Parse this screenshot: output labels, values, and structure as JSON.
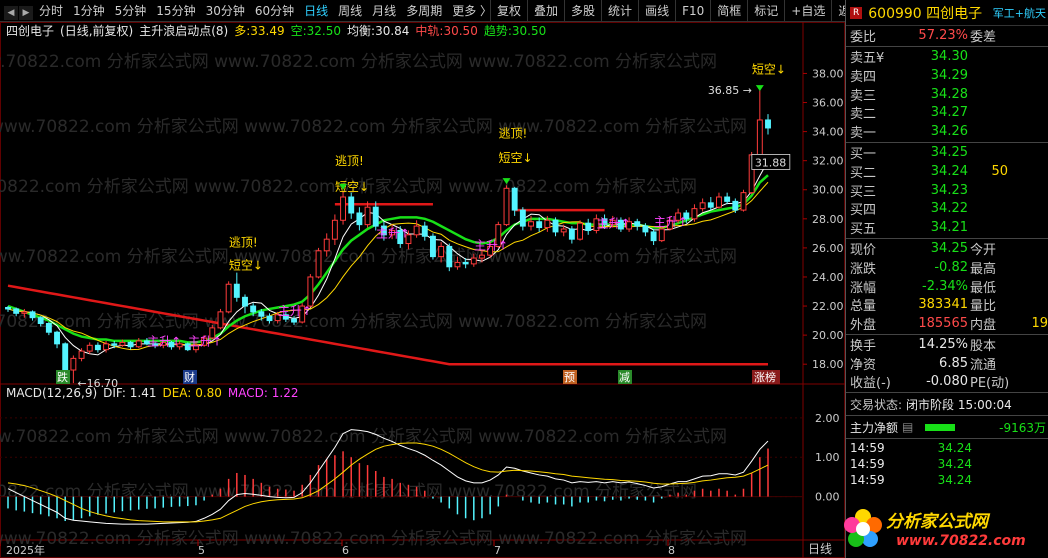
{
  "toolbar": {
    "periods": [
      "分时",
      "1分钟",
      "5分钟",
      "15分钟",
      "30分钟",
      "60分钟",
      "日线",
      "周线",
      "月线",
      "多周期",
      "更多 〉"
    ],
    "active": "日线",
    "right_buttons": [
      "复权",
      "叠加",
      "多股",
      "统计",
      "画线",
      "F10",
      "简框",
      "标记",
      "+自选",
      "返回"
    ]
  },
  "legend": {
    "stock": "四创电子",
    "mode": "(日线,前复权)",
    "indicator": "主升浪启动点(8)",
    "duo_label": "多:",
    "duo_value": "33.49",
    "kong_label": "空:",
    "kong_value": "32.50",
    "junheng_label": "均衡:",
    "junheng_value": "30.84",
    "zhonggui_label": "中轨:",
    "zhonggui_value": "30.50",
    "qushi_label": "趋势:",
    "qushi_value": "30.50"
  },
  "macd_legend": {
    "name": "MACD(12,26,9)",
    "dif_label": "DIF:",
    "dif_value": "1.41",
    "dea_label": "DEA:",
    "dea_value": "0.80",
    "macd_label": "MACD:",
    "macd_value": "1.22"
  },
  "chart_data": {
    "type": "candlestick",
    "price_axis_ticks": [
      "38.00",
      "36.00",
      "34.00",
      "32.00",
      "30.00",
      "28.00",
      "26.00",
      "24.00",
      "22.00",
      "20.00",
      "18.00"
    ],
    "macd_axis_ticks": [
      "2.00",
      "1.00",
      "0.00"
    ],
    "time_labels": [
      "2025年",
      "5",
      "6",
      "7",
      "8"
    ],
    "period_label": "日线",
    "price_range": [
      16.5,
      39.2
    ],
    "macd_range": [
      -1.0,
      2.3
    ],
    "candles": [
      [
        21.9,
        21.8,
        22.0,
        21.6
      ],
      [
        21.8,
        21.5,
        21.9,
        21.3
      ],
      [
        21.5,
        21.6,
        21.8,
        21.2
      ],
      [
        21.6,
        21.2,
        21.7,
        21.0
      ],
      [
        21.2,
        20.8,
        21.3,
        20.6
      ],
      [
        20.8,
        20.2,
        20.9,
        20.0
      ],
      [
        20.2,
        19.4,
        20.3,
        19.1
      ],
      [
        19.4,
        17.6,
        19.5,
        17.3
      ],
      [
        17.6,
        18.4,
        18.6,
        16.7
      ],
      [
        18.4,
        18.9,
        19.1,
        18.2
      ],
      [
        18.9,
        19.3,
        19.5,
        18.7
      ],
      [
        19.3,
        19.0,
        19.5,
        18.8
      ],
      [
        19.0,
        19.4,
        19.6,
        18.8
      ],
      [
        19.4,
        19.3,
        19.6,
        19.1
      ],
      [
        19.3,
        19.5,
        19.7,
        19.2
      ],
      [
        19.5,
        19.2,
        19.6,
        19.0
      ],
      [
        19.2,
        19.6,
        19.8,
        19.1
      ],
      [
        19.6,
        19.4,
        19.8,
        19.3
      ],
      [
        19.4,
        19.3,
        19.5,
        19.1
      ],
      [
        19.3,
        19.5,
        19.6,
        19.1
      ],
      [
        19.5,
        19.2,
        19.6,
        19.0
      ],
      [
        19.2,
        19.4,
        19.6,
        19.0
      ],
      [
        19.4,
        19.0,
        19.5,
        18.9
      ],
      [
        19.0,
        19.3,
        19.5,
        18.8
      ],
      [
        19.3,
        19.8,
        20.0,
        19.2
      ],
      [
        19.8,
        20.5,
        20.7,
        19.7
      ],
      [
        20.5,
        21.6,
        21.8,
        20.4
      ],
      [
        21.6,
        23.5,
        23.7,
        21.5
      ],
      [
        23.5,
        22.6,
        24.3,
        22.3
      ],
      [
        22.6,
        22.0,
        22.8,
        21.5
      ],
      [
        22.0,
        21.6,
        22.2,
        21.3
      ],
      [
        21.6,
        21.3,
        21.8,
        21.0
      ],
      [
        21.3,
        21.0,
        21.5,
        20.8
      ],
      [
        21.0,
        21.4,
        21.6,
        20.8
      ],
      [
        21.4,
        21.1,
        21.6,
        20.9
      ],
      [
        21.1,
        20.9,
        21.3,
        20.7
      ],
      [
        20.9,
        22.0,
        22.2,
        20.8
      ],
      [
        22.0,
        24.0,
        24.2,
        21.9
      ],
      [
        24.0,
        25.8,
        26.0,
        23.9
      ],
      [
        25.8,
        26.6,
        27.0,
        25.4
      ],
      [
        26.6,
        27.9,
        28.3,
        26.2
      ],
      [
        27.9,
        29.5,
        29.9,
        27.6
      ],
      [
        29.5,
        28.4,
        29.8,
        28.0
      ],
      [
        28.4,
        27.6,
        28.8,
        27.2
      ],
      [
        27.6,
        28.8,
        29.2,
        27.4
      ],
      [
        28.8,
        27.5,
        29.2,
        27.2
      ],
      [
        27.5,
        26.9,
        27.8,
        26.5
      ],
      [
        26.9,
        27.2,
        27.6,
        26.6
      ],
      [
        27.2,
        26.3,
        27.5,
        26.0
      ],
      [
        26.3,
        26.9,
        27.2,
        25.9
      ],
      [
        26.9,
        27.5,
        27.9,
        26.7
      ],
      [
        27.5,
        26.8,
        27.8,
        26.5
      ],
      [
        26.8,
        25.4,
        27.0,
        25.2
      ],
      [
        25.4,
        26.1,
        26.4,
        25.0
      ],
      [
        26.1,
        24.7,
        26.3,
        24.4
      ],
      [
        24.7,
        25.0,
        25.4,
        24.5
      ],
      [
        25.0,
        24.9,
        25.3,
        24.6
      ],
      [
        24.9,
        25.3,
        25.6,
        24.7
      ],
      [
        25.3,
        25.5,
        25.9,
        25.0
      ],
      [
        25.5,
        26.1,
        26.4,
        25.3
      ],
      [
        26.1,
        27.6,
        27.8,
        26.0
      ],
      [
        27.6,
        30.1,
        30.3,
        27.5
      ],
      [
        30.1,
        28.6,
        30.2,
        28.2
      ],
      [
        28.6,
        27.5,
        28.8,
        27.2
      ],
      [
        27.5,
        27.8,
        28.2,
        27.2
      ],
      [
        27.8,
        27.4,
        28.1,
        27.1
      ],
      [
        27.4,
        27.9,
        28.2,
        27.1
      ],
      [
        27.9,
        27.1,
        28.1,
        26.8
      ],
      [
        27.1,
        27.3,
        27.6,
        26.8
      ],
      [
        27.3,
        26.6,
        27.5,
        26.3
      ],
      [
        26.6,
        27.7,
        27.9,
        26.5
      ],
      [
        27.7,
        27.2,
        28.0,
        26.9
      ],
      [
        27.2,
        28.0,
        28.3,
        27.0
      ],
      [
        28.0,
        27.6,
        28.3,
        27.3
      ],
      [
        27.6,
        27.9,
        28.2,
        27.4
      ],
      [
        27.9,
        27.3,
        28.1,
        27.1
      ],
      [
        27.3,
        27.8,
        28.1,
        27.1
      ],
      [
        27.8,
        27.5,
        28.0,
        27.2
      ],
      [
        27.5,
        27.1,
        27.7,
        26.8
      ],
      [
        27.1,
        26.5,
        27.3,
        26.2
      ],
      [
        26.5,
        27.3,
        27.5,
        26.4
      ],
      [
        27.3,
        27.9,
        28.2,
        27.2
      ],
      [
        27.9,
        28.4,
        28.7,
        27.7
      ],
      [
        28.4,
        28.0,
        28.6,
        27.7
      ],
      [
        28.0,
        28.7,
        29.0,
        27.8
      ],
      [
        28.7,
        29.1,
        29.4,
        28.5
      ],
      [
        29.1,
        28.8,
        29.5,
        28.6
      ],
      [
        28.8,
        29.5,
        29.8,
        28.7
      ],
      [
        29.5,
        29.2,
        29.8,
        29.0
      ],
      [
        29.2,
        28.6,
        29.4,
        28.4
      ],
      [
        28.6,
        29.8,
        30.0,
        28.5
      ],
      [
        29.8,
        32.4,
        32.6,
        29.7
      ],
      [
        32.4,
        34.8,
        36.85,
        32.2
      ],
      [
        34.8,
        34.25,
        35.2,
        33.8
      ]
    ],
    "ma_red": [
      23.4,
      23.3,
      23.2,
      23.1,
      23.0,
      22.9,
      22.8,
      22.7,
      22.6,
      22.5,
      22.4,
      22.3,
      22.2,
      22.1,
      22.0,
      21.9,
      21.8,
      21.7,
      21.6,
      21.5,
      21.4,
      21.3,
      21.2,
      21.1,
      21.0,
      20.9,
      20.8,
      20.7,
      20.6,
      20.5,
      20.4,
      20.3,
      20.2,
      20.1,
      20.0,
      19.9,
      19.8,
      19.7,
      19.6,
      19.5,
      19.4,
      19.3,
      19.2,
      19.1,
      19.0,
      18.9,
      18.8,
      18.7,
      18.6,
      18.5,
      18.4,
      18.3,
      18.2,
      18.1,
      18.0,
      18.0,
      18.0,
      18.0,
      18.0,
      18.0,
      18.0,
      18.0,
      18.0,
      18.0,
      18.0,
      18.0,
      18.0,
      18.0,
      18.0,
      18.0,
      18.0,
      18.0,
      18.0,
      18.0,
      18.0,
      18.0,
      18.0,
      18.0,
      18.0,
      18.0,
      18.0,
      18.0,
      18.0,
      18.0,
      18.0,
      18.0,
      18.0,
      18.0,
      18.0,
      18.0,
      18.0,
      18.0,
      18.0,
      18.0
    ],
    "ma_green": [
      22.0,
      21.8,
      21.6,
      21.4,
      21.2,
      21.0,
      20.7,
      20.4,
      20.1,
      19.9,
      19.8,
      19.7,
      19.7,
      19.6,
      19.6,
      19.6,
      19.6,
      19.6,
      19.6,
      19.6,
      19.6,
      19.6,
      19.5,
      19.5,
      19.6,
      19.8,
      20.1,
      20.6,
      21.0,
      21.3,
      21.5,
      21.7,
      21.8,
      21.9,
      22.0,
      22.1,
      22.3,
      22.8,
      23.5,
      24.3,
      25.1,
      25.9,
      26.5,
      26.9,
      27.3,
      27.6,
      27.9,
      28.0,
      28.1,
      28.1,
      28.1,
      28.0,
      27.8,
      27.5,
      27.2,
      26.9,
      26.6,
      26.4,
      26.3,
      26.4,
      26.7,
      27.2,
      27.6,
      27.8,
      28.0,
      28.0,
      28.0,
      27.9,
      27.8,
      27.7,
      27.7,
      27.6,
      27.6,
      27.6,
      27.6,
      27.6,
      27.6,
      27.6,
      27.5,
      27.4,
      27.4,
      27.5,
      27.7,
      27.9,
      28.1,
      28.3,
      28.5,
      28.6,
      28.7,
      28.8,
      29.0,
      29.6,
      30.5,
      31.0
    ],
    "macd_hist": [
      -0.3,
      -0.35,
      -0.38,
      -0.42,
      -0.45,
      -0.5,
      -0.55,
      -0.62,
      -0.6,
      -0.55,
      -0.5,
      -0.46,
      -0.43,
      -0.4,
      -0.37,
      -0.35,
      -0.33,
      -0.31,
      -0.3,
      -0.28,
      -0.26,
      -0.25,
      -0.24,
      -0.22,
      -0.1,
      0.05,
      0.2,
      0.45,
      0.6,
      0.55,
      0.45,
      0.35,
      0.25,
      0.2,
      0.18,
      0.15,
      0.3,
      0.55,
      0.8,
      0.95,
      1.05,
      1.15,
      1.0,
      0.85,
      0.8,
      0.65,
      0.5,
      0.45,
      0.35,
      0.3,
      0.25,
      0.15,
      -0.05,
      -0.15,
      -0.3,
      -0.45,
      -0.55,
      -0.6,
      -0.55,
      -0.45,
      -0.25,
      0.05,
      0.0,
      -0.1,
      -0.15,
      -0.18,
      -0.15,
      -0.2,
      -0.2,
      -0.25,
      -0.15,
      -0.15,
      -0.1,
      -0.12,
      -0.08,
      -0.1,
      -0.05,
      -0.08,
      -0.1,
      -0.15,
      -0.05,
      0.05,
      0.1,
      0.05,
      0.15,
      0.2,
      0.15,
      0.2,
      0.15,
      0.05,
      0.2,
      0.6,
      1.0,
      1.22
    ],
    "dif": [
      0.2,
      0.1,
      0.0,
      -0.1,
      -0.2,
      -0.3,
      -0.4,
      -0.55,
      -0.6,
      -0.62,
      -0.64,
      -0.66,
      -0.68,
      -0.69,
      -0.7,
      -0.7,
      -0.7,
      -0.7,
      -0.69,
      -0.68,
      -0.67,
      -0.66,
      -0.65,
      -0.63,
      -0.55,
      -0.45,
      -0.32,
      -0.1,
      0.05,
      0.08,
      0.06,
      0.03,
      0.0,
      -0.02,
      -0.03,
      -0.02,
      0.1,
      0.35,
      0.65,
      0.95,
      1.25,
      1.6,
      1.7,
      1.68,
      1.65,
      1.58,
      1.48,
      1.4,
      1.3,
      1.22,
      1.15,
      1.05,
      0.92,
      0.8,
      0.65,
      0.5,
      0.4,
      0.35,
      0.35,
      0.42,
      0.55,
      0.75,
      0.72,
      0.65,
      0.6,
      0.55,
      0.52,
      0.45,
      0.42,
      0.35,
      0.38,
      0.36,
      0.38,
      0.35,
      0.38,
      0.35,
      0.37,
      0.33,
      0.28,
      0.22,
      0.25,
      0.32,
      0.38,
      0.38,
      0.45,
      0.52,
      0.53,
      0.58,
      0.58,
      0.55,
      0.62,
      0.9,
      1.2,
      1.41
    ],
    "dea": [
      0.35,
      0.32,
      0.28,
      0.22,
      0.15,
      0.08,
      0.0,
      -0.1,
      -0.2,
      -0.3,
      -0.38,
      -0.44,
      -0.49,
      -0.53,
      -0.56,
      -0.59,
      -0.61,
      -0.62,
      -0.63,
      -0.64,
      -0.64,
      -0.64,
      -0.64,
      -0.64,
      -0.62,
      -0.59,
      -0.55,
      -0.45,
      -0.35,
      -0.25,
      -0.18,
      -0.13,
      -0.1,
      -0.08,
      -0.07,
      -0.06,
      -0.03,
      0.05,
      0.15,
      0.3,
      0.45,
      0.62,
      0.8,
      0.95,
      1.08,
      1.2,
      1.28,
      1.32,
      1.35,
      1.36,
      1.36,
      1.33,
      1.28,
      1.2,
      1.1,
      0.98,
      0.86,
      0.76,
      0.68,
      0.63,
      0.62,
      0.65,
      0.67,
      0.66,
      0.65,
      0.63,
      0.61,
      0.58,
      0.56,
      0.52,
      0.5,
      0.48,
      0.46,
      0.44,
      0.43,
      0.41,
      0.4,
      0.39,
      0.37,
      0.34,
      0.32,
      0.32,
      0.33,
      0.34,
      0.36,
      0.4,
      0.42,
      0.45,
      0.48,
      0.49,
      0.52,
      0.6,
      0.7,
      0.8
    ]
  },
  "annotations": {
    "low_mark": "←16.70",
    "high_mark": "36.85 →",
    "price_box": "31.88",
    "escape_top": "逃顶!",
    "short_sell": "短空↓",
    "main_rise": "主升↑",
    "badge_die": "跌",
    "badge_cai": "财",
    "badge_yu": "预",
    "badge_jian": "减",
    "badge_zhangbang": "涨榜"
  },
  "watermark": "www.70822.com 分析家公式网",
  "quote": {
    "r_badge": "R",
    "code_name": "600990 四创电子",
    "tag": "军工+航天",
    "weibi_label": "委比",
    "weibi_value": "57.23%",
    "weicha_label": "委差",
    "asks": [
      {
        "label": "卖五",
        "mark": "¥",
        "price": "34.30",
        "vol": ""
      },
      {
        "label": "卖四",
        "mark": "",
        "price": "34.29",
        "vol": ""
      },
      {
        "label": "卖三",
        "mark": "",
        "price": "34.28",
        "vol": ""
      },
      {
        "label": "卖二",
        "mark": "",
        "price": "34.27",
        "vol": ""
      },
      {
        "label": "卖一",
        "mark": "",
        "price": "34.26",
        "vol": ""
      }
    ],
    "bids": [
      {
        "label": "买一",
        "price": "34.25",
        "vol": ""
      },
      {
        "label": "买二",
        "price": "34.24",
        "vol": "50"
      },
      {
        "label": "买三",
        "price": "34.23",
        "vol": ""
      },
      {
        "label": "买四",
        "price": "34.22",
        "vol": ""
      },
      {
        "label": "买五",
        "price": "34.21",
        "vol": ""
      }
    ],
    "stats": [
      {
        "l1": "现价",
        "v1": "34.25",
        "c1": "green",
        "l2": "今开",
        "v2": "",
        "c2": "white"
      },
      {
        "l1": "涨跌",
        "v1": "-0.82",
        "c1": "green",
        "l2": "最高",
        "v2": "",
        "c2": "white"
      },
      {
        "l1": "涨幅",
        "v1": "-2.34%",
        "c1": "green",
        "l2": "最低",
        "v2": "",
        "c2": "white"
      },
      {
        "l1": "总量",
        "v1": "383341",
        "c1": "yellow",
        "l2": "量比",
        "v2": "",
        "c2": "white"
      },
      {
        "l1": "外盘",
        "v1": "185565",
        "c1": "red",
        "l2": "内盘",
        "v2": "19",
        "c2": "green"
      }
    ],
    "stats2": [
      {
        "l1": "换手",
        "v1": "14.25%",
        "c1": "white",
        "l2": "股本",
        "v2": ""
      },
      {
        "l1": "净资",
        "v1": "6.85",
        "c1": "white",
        "l2": "流通",
        "v2": ""
      },
      {
        "l1": "收益(-)",
        "v1": "-0.080",
        "c1": "white",
        "l2": "PE(动)",
        "v2": ""
      }
    ],
    "state_label": "交易状态:",
    "state_value": "闭市阶段 15:00:04",
    "netflow_label": "主力净额",
    "netflow_value": "-9163万",
    "ticks": [
      {
        "time": "14:59",
        "price": "34.24"
      },
      {
        "time": "14:59",
        "price": "34.24"
      },
      {
        "time": "14:59",
        "price": "34.24"
      }
    ]
  },
  "logo": {
    "title": "分析家公式网",
    "url": "www.70822.com"
  },
  "colors": {
    "up": "#ff3b3b",
    "down": "#54f4ff",
    "ma_red": "#e01818",
    "ma_green": "#18e018",
    "ma_yellow": "#ffd800",
    "ma_white": "#ffffff",
    "grid": "#600000"
  }
}
